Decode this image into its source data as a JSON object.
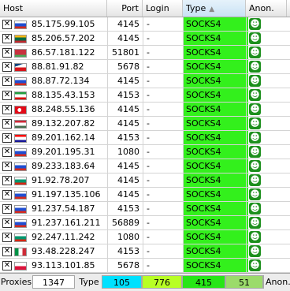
{
  "header": {
    "host": "Host",
    "port": "Port",
    "login": "Login",
    "type": "Type",
    "anon": "Anon."
  },
  "rows": [
    {
      "flag": "ru",
      "ip": "85.175.99.105",
      "port": "4145",
      "login": "-",
      "type": "SOCKS4"
    },
    {
      "flag": "lt",
      "ip": "85.206.57.202",
      "port": "4145",
      "login": "-",
      "type": "SOCKS4"
    },
    {
      "flag": "by",
      "ip": "86.57.181.122",
      "port": "51801",
      "login": "-",
      "type": "SOCKS4"
    },
    {
      "flag": "cz",
      "ip": "88.81.91.82",
      "port": "5678",
      "login": "-",
      "type": "SOCKS4"
    },
    {
      "flag": "ru",
      "ip": "88.87.72.134",
      "port": "4145",
      "login": "-",
      "type": "SOCKS4"
    },
    {
      "flag": "ir",
      "ip": "88.135.43.153",
      "port": "4153",
      "login": "-",
      "type": "SOCKS4"
    },
    {
      "flag": "tr",
      "ip": "88.248.55.136",
      "port": "4145",
      "login": "-",
      "type": "SOCKS4"
    },
    {
      "flag": "hu",
      "ip": "89.132.207.82",
      "port": "4145",
      "login": "-",
      "type": "SOCKS4"
    },
    {
      "flag": "hr",
      "ip": "89.201.162.14",
      "port": "4153",
      "login": "-",
      "type": "SOCKS4"
    },
    {
      "flag": "ru",
      "ip": "89.201.195.31",
      "port": "1080",
      "login": "-",
      "type": "SOCKS4"
    },
    {
      "flag": "ru",
      "ip": "89.233.183.64",
      "port": "4145",
      "login": "-",
      "type": "SOCKS4"
    },
    {
      "flag": "bg",
      "ip": "91.92.78.207",
      "port": "4145",
      "login": "-",
      "type": "SOCKS4"
    },
    {
      "flag": "ru",
      "ip": "91.197.135.106",
      "port": "4145",
      "login": "-",
      "type": "SOCKS4"
    },
    {
      "flag": "ru",
      "ip": "91.237.54.187",
      "port": "4153",
      "login": "-",
      "type": "SOCKS4"
    },
    {
      "flag": "ru",
      "ip": "91.237.161.211",
      "port": "56889",
      "login": "-",
      "type": "SOCKS4"
    },
    {
      "flag": "bg",
      "ip": "92.247.11.242",
      "port": "1080",
      "login": "-",
      "type": "SOCKS4"
    },
    {
      "flag": "it",
      "ip": "93.48.228.247",
      "port": "4153",
      "login": "-",
      "type": "SOCKS4"
    },
    {
      "flag": "pl",
      "ip": "93.113.101.85",
      "port": "5678",
      "login": "-",
      "type": "SOCKS4"
    }
  ],
  "status": {
    "proxies_label": "Proxies",
    "proxies_count": "1347",
    "type_label": "Type",
    "counts": [
      "105",
      "776",
      "415",
      "51"
    ],
    "anon_label": "Anon."
  },
  "colors": {
    "socks4_cell": "#33f01c",
    "anon_icon": "#1c8f1c"
  }
}
